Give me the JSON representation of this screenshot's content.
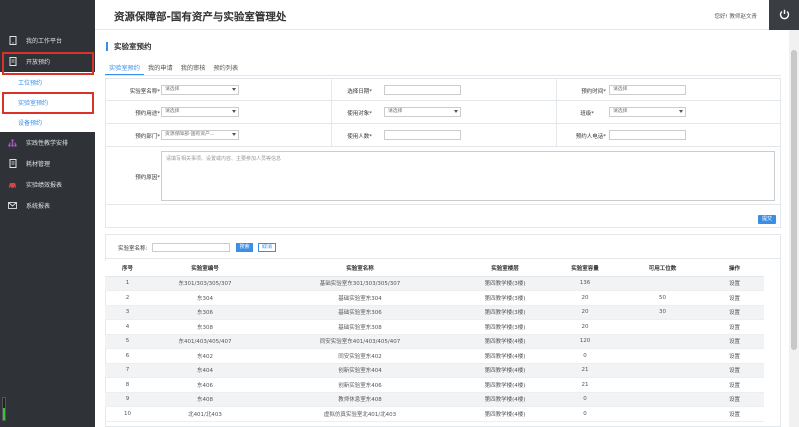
{
  "header": {
    "title": "资源保障部-国有资产与实验室管理处",
    "greeting": "您好! 教师赵文青"
  },
  "sidebar": {
    "items": [
      {
        "label": "我的工作平台",
        "icon": "tablet-icon"
      },
      {
        "label": "开放预约",
        "icon": "document-icon"
      },
      {
        "label": "实践性教学安排",
        "icon": "sitemap-icon"
      },
      {
        "label": "耗材管理",
        "icon": "file-icon"
      },
      {
        "label": "实验绩效报表",
        "icon": "car-icon"
      },
      {
        "label": "系统报表",
        "icon": "envelope-icon"
      }
    ],
    "subitems": [
      "工位预约",
      "实验室预约",
      "设备预约"
    ]
  },
  "page": {
    "title": "实验室预约",
    "tabs": [
      "实验室预约",
      "我的申请",
      "我的审核",
      "预约列表"
    ]
  },
  "form": {
    "lab_name_label": "实验室名称*",
    "lab_name_value": "请选择",
    "date_label": "选择日期*",
    "time_label": "预约时间*",
    "time_value": "请选择",
    "purpose_label": "预约用途*",
    "purpose_value": "请选择",
    "target_label": "使用对象*",
    "target_value": "请选择",
    "grade_label": "班级*",
    "grade_value": "请选择",
    "dept_label": "预约部门*",
    "dept_value": "资源保障部-国有资产...",
    "people_label": "使用人数*",
    "phone_label": "预约人电话*",
    "reason_label": "预约原因*",
    "reason_placeholder": "请填写相关事项、设置或内容、主要参加人员等信息",
    "submit": "提交"
  },
  "search": {
    "label": "实验室名称:",
    "search_btn": "搜索",
    "cancel_btn": "取消"
  },
  "table": {
    "headers": [
      "序号",
      "实验室编号",
      "实验室名称",
      "实验室楼层",
      "实验室容量",
      "可用工位数",
      "操作"
    ],
    "rows": [
      [
        "1",
        "东301/303/305/307",
        "基础实验室东301/303/305/307",
        "第四教学楼(3楼)",
        "136",
        "",
        "设置"
      ],
      [
        "2",
        "东304",
        "基础实验室东304",
        "第四教学楼(3楼)",
        "20",
        "50",
        "设置"
      ],
      [
        "3",
        "东306",
        "基础实验室东306",
        "第四教学楼(3楼)",
        "20",
        "30",
        "设置"
      ],
      [
        "4",
        "东308",
        "基础实验室东308",
        "第四教学楼(3楼)",
        "20",
        "",
        "设置"
      ],
      [
        "5",
        "东401/403/405/407",
        "同安实验室东401/403/405/407",
        "第四教学楼(4楼)",
        "120",
        "",
        "设置"
      ],
      [
        "6",
        "东402",
        "同安实验室东402",
        "第四教学楼(4楼)",
        "0",
        "",
        "设置"
      ],
      [
        "7",
        "东404",
        "创新实验室东404",
        "第四教学楼(4楼)",
        "21",
        "",
        "设置"
      ],
      [
        "8",
        "东406",
        "创新实验室东406",
        "第四教学楼(4楼)",
        "21",
        "",
        "设置"
      ],
      [
        "9",
        "东408",
        "教师休息室东408",
        "第四教学楼(4楼)",
        "0",
        "",
        "设置"
      ],
      [
        "10",
        "北401/北403",
        "虚拟仿真实验室北401/北403",
        "第四教学楼(4楼)",
        "0",
        "",
        "设置"
      ]
    ]
  },
  "colors": {
    "accent": "#3a8ee6",
    "sidebar_bg": "#2f3237",
    "highlight": "#d9322a"
  }
}
